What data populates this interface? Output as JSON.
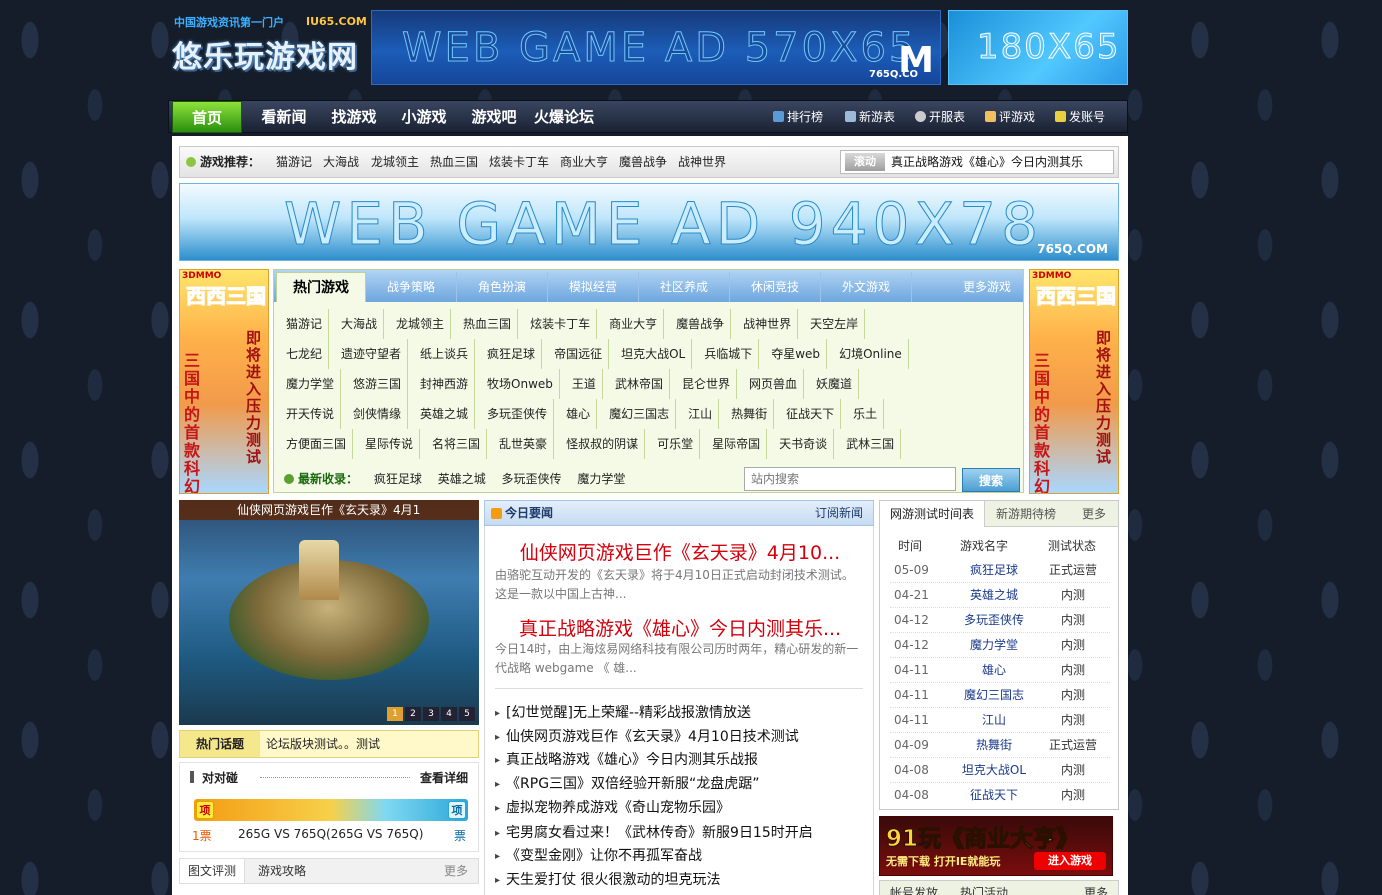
{
  "header": {
    "slogan": "中国游戏资讯第一门户",
    "domain": "IU65.COM",
    "site_name": "悠乐玩游戏网",
    "ad_570": {
      "text": "WEB GAME AD 570X65",
      "brand": "765Q.CO",
      "brand_mark": "M"
    },
    "ad_180": {
      "text": "180X65"
    }
  },
  "nav": {
    "items": [
      "首页",
      "看新闻",
      "找游戏",
      "小游戏",
      "游戏吧",
      "火爆论坛"
    ],
    "right": [
      {
        "label": "排行榜",
        "icon": "chart-icon",
        "color": "#5b9bd5"
      },
      {
        "label": "新游表",
        "icon": "table-icon",
        "color": "#9bbbd9"
      },
      {
        "label": "开服表",
        "icon": "clock-icon",
        "color": "#cccccc"
      },
      {
        "label": "评游戏",
        "icon": "edit-icon",
        "color": "#f0c060"
      },
      {
        "label": "发账号",
        "icon": "account-icon",
        "color": "#e8d040"
      }
    ]
  },
  "recommend": {
    "label": "游戏推荐：",
    "links": [
      "猫游记",
      "大海战",
      "龙城领主",
      "热血三国",
      "炫装卡丁车",
      "商业大亨",
      "魔兽战争",
      "战神世界"
    ],
    "scroll_tag": "滚动",
    "scroll_text": "真正战略游戏《雄心》今日内测其乐"
  },
  "ad_940": {
    "text": "WEB GAME AD 940X78",
    "brand": "765Q.COM"
  },
  "side_ads": {
    "tag": "3DMMO",
    "title": "西西三国",
    "sub_left": "三国中的首款科幻",
    "sub_right": "即将进入压力测试"
  },
  "games": {
    "tabs": [
      "热门游戏",
      "战争策略",
      "角色扮演",
      "模拟经营",
      "社区养成",
      "休闲竞技",
      "外文游戏"
    ],
    "more": "更多游戏",
    "rows": [
      [
        "猫游记",
        "大海战",
        "龙城领主",
        "热血三国",
        "炫装卡丁车",
        "商业大亨",
        "魔兽战争",
        "战神世界",
        "天空左岸"
      ],
      [
        "七龙纪",
        "遗迹守望者",
        "纸上谈兵",
        "疯狂足球",
        "帝国远征",
        "坦克大战OL",
        "兵临城下",
        "夺星web",
        "幻境Online"
      ],
      [
        "魔力学堂",
        "悠游三国",
        "封神西游",
        "牧场Onweb",
        "王道",
        "武林帝国",
        "昆仑世界",
        "网页兽血",
        "妖魔道"
      ],
      [
        "开天传说",
        "剑侠情缘",
        "英雄之城",
        "多玩歪侠传",
        "雄心",
        "魔幻三国志",
        "江山",
        "热舞街",
        "征战天下",
        "乐土"
      ],
      [
        "方便面三国",
        "星际传说",
        "名将三国",
        "乱世英豪",
        "怪叔叔的阴谋",
        "可乐堂",
        "星际帝国",
        "天书奇谈",
        "武林三国"
      ]
    ],
    "newest_label": "最新收录：",
    "newest": [
      "疯狂足球",
      "英雄之城",
      "多玩歪侠传",
      "魔力学堂"
    ],
    "search_placeholder": "站内搜索",
    "search_button": "搜索"
  },
  "slideshow": {
    "caption": "仙侠网页游戏巨作《玄天录》4月1",
    "pages": [
      "1",
      "2",
      "3",
      "4",
      "5"
    ],
    "active": 1
  },
  "hot_topic": {
    "label": "热门话题",
    "text": "论坛版块测试。。测试"
  },
  "pk": {
    "title": "对对碰",
    "more": "查看详细",
    "left_badge": "项",
    "right_badge": "项",
    "left_votes": "1票",
    "right_votes": "票",
    "matchup": "265G VS 765Q(265G VS 765Q)",
    "left_share": 0.5
  },
  "review_tabs": {
    "tabs": [
      "图文评测",
      "游戏攻略"
    ],
    "more": "更多"
  },
  "news": {
    "header": "今日要闻",
    "subscribe": "订阅新闻",
    "headlines": [
      {
        "title": "仙侠网页游戏巨作《玄天录》4月10...",
        "summary": "由骆驼互动开发的《玄天录》将于4月10日正式启动封闭技术测试。这是一款以中国上古神..."
      },
      {
        "title": "真正战略游戏《雄心》今日内测其乐...",
        "summary": "今日14时，由上海炫易网络科技有限公司历时两年，精心研发的新一代战略 webgame 《 雄..."
      }
    ],
    "items": [
      "[幻世觉醒]无上荣耀--精彩战报激情放送",
      "仙侠网页游戏巨作《玄天录》4月10日技术测试",
      "真正战略游戏《雄心》今日内测其乐战报",
      "《RPG三国》双倍经验开新服“龙盘虎踞”",
      "虚拟宠物养成游戏《奇山宠物乐园》",
      "宅男腐女看过来！《武林传奇》新服9日15时开启",
      "《变型金刚》让你不再孤军奋战",
      "天生爱打仗 很火很激动的坦克玩法"
    ]
  },
  "schedule": {
    "tabs": [
      "网游测试时间表",
      "新游期待榜",
      "更多"
    ],
    "headers": [
      "时间",
      "游戏名字",
      "测试状态"
    ],
    "rows": [
      [
        "05-09",
        "疯狂足球",
        "正式运营"
      ],
      [
        "04-21",
        "英雄之城",
        "内测"
      ],
      [
        "04-12",
        "多玩歪侠传",
        "内测"
      ],
      [
        "04-12",
        "魔力学堂",
        "内测"
      ],
      [
        "04-11",
        "雄心",
        "内测"
      ],
      [
        "04-11",
        "魔幻三国志",
        "内测"
      ],
      [
        "04-11",
        "江山",
        "内测"
      ],
      [
        "04-09",
        "热舞街",
        "正式运营"
      ],
      [
        "04-08",
        "坦克大战OL",
        "内测"
      ],
      [
        "04-08",
        "征战天下",
        "内测"
      ]
    ]
  },
  "ad_91": {
    "title": "91玩《商业大亨》",
    "tagline": "无需下载 打开IE就能玩",
    "button": "进入游戏"
  },
  "account_tabs": {
    "tabs": [
      "帐号发放",
      "热门活动"
    ],
    "more": "更多"
  }
}
